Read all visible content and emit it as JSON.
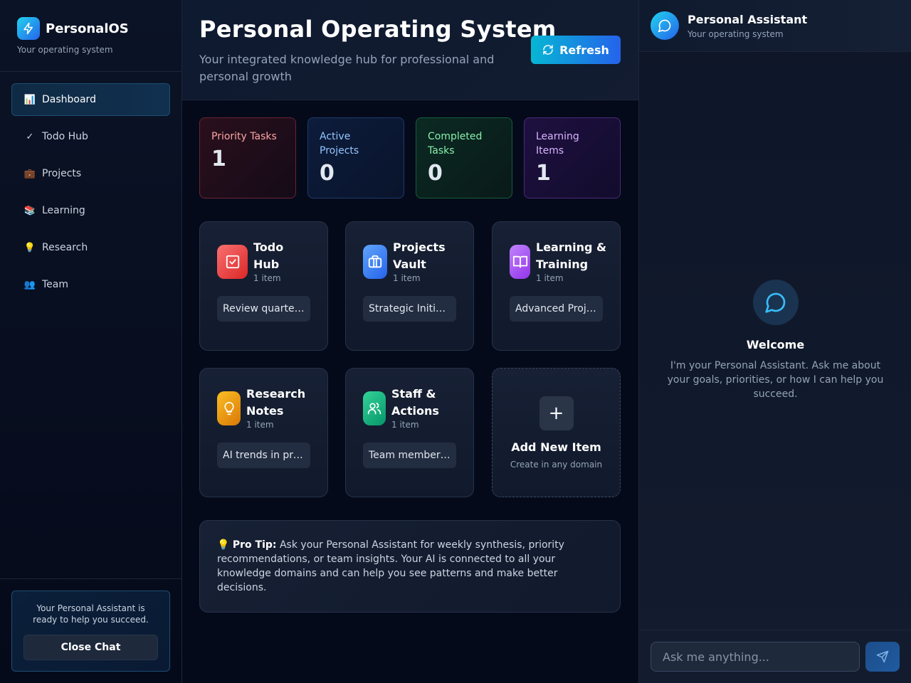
{
  "app": {
    "name": "PersonalOS",
    "subtitle": "Your operating system"
  },
  "sidebar": {
    "items": [
      {
        "icon": "📊",
        "label": "Dashboard",
        "active": true
      },
      {
        "icon": "✓",
        "label": "Todo Hub"
      },
      {
        "icon": "💼",
        "label": "Projects"
      },
      {
        "icon": "📚",
        "label": "Learning"
      },
      {
        "icon": "💡",
        "label": "Research"
      },
      {
        "icon": "👥",
        "label": "Team"
      }
    ],
    "footer": {
      "text": "Your Personal Assistant is ready to help you succeed.",
      "close_label": "Close Chat"
    }
  },
  "header": {
    "title": "Personal Operating System",
    "subtitle": "Your integrated knowledge hub for professional and personal growth",
    "refresh_label": "Refresh"
  },
  "stats": [
    {
      "label": "Priority Tasks",
      "value": "1"
    },
    {
      "label": "Active Projects",
      "value": "0"
    },
    {
      "label": "Completed Tasks",
      "value": "0"
    },
    {
      "label": "Learning Items",
      "value": "1"
    }
  ],
  "cards": [
    {
      "title": "Todo Hub",
      "count": "1 item",
      "preview": "Review quarterly goals",
      "icon": "check-square-icon",
      "color": "#ef4444"
    },
    {
      "title": "Projects Vault",
      "count": "1 item",
      "preview": "Strategic Initiative",
      "icon": "briefcase-icon",
      "color": "#3b82f6"
    },
    {
      "title": "Learning & Training",
      "count": "1 item",
      "preview": "Advanced Project Management",
      "icon": "book-open-icon",
      "color": "#a855f7"
    },
    {
      "title": "Research Notes",
      "count": "1 item",
      "preview": "AI trends in productivity",
      "icon": "lightbulb-icon",
      "color": "#f59e0b"
    },
    {
      "title": "Staff & Actions",
      "count": "1 item",
      "preview": "Team member check-in",
      "icon": "users-icon",
      "color": "#10b981"
    }
  ],
  "add_card": {
    "title": "Add New Item",
    "subtitle": "Create in any domain",
    "plus": "+"
  },
  "tip": {
    "icon": "💡",
    "label": "Pro Tip:",
    "text": "Ask your Personal Assistant for weekly synthesis, priority recommendations, or team insights. Your AI is connected to all your knowledge domains and can help you see patterns and make better decisions."
  },
  "chat": {
    "title": "Personal Assistant",
    "subtitle": "Your operating system",
    "welcome_title": "Welcome",
    "welcome_text": "I'm your Personal Assistant. Ask me about your goals, priorities, or how I can help you succeed.",
    "input_placeholder": "Ask me anything..."
  }
}
